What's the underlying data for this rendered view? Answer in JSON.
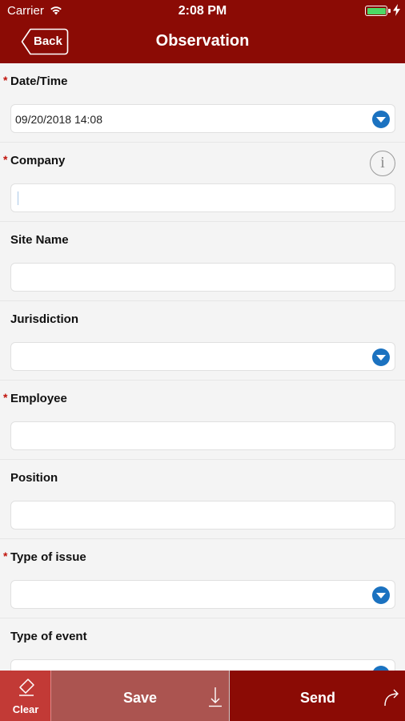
{
  "status_bar": {
    "carrier": "Carrier",
    "time": "2:08 PM"
  },
  "header": {
    "title": "Observation",
    "back_label": "Back"
  },
  "fields": {
    "datetime": {
      "label": "Date/Time",
      "required": "*",
      "value": "09/20/2018 14:08",
      "control": "dropdown"
    },
    "company": {
      "label": "Company",
      "required": "*",
      "value": "",
      "info_icon": "i"
    },
    "site_name": {
      "label": "Site Name",
      "value": ""
    },
    "jurisdiction": {
      "label": "Jurisdiction",
      "value": "",
      "control": "dropdown"
    },
    "employee": {
      "label": "Employee",
      "required": "*",
      "value": ""
    },
    "position": {
      "label": "Position",
      "value": ""
    },
    "type_of_issue": {
      "label": "Type of issue",
      "required": "*",
      "value": "",
      "control": "dropdown"
    },
    "type_of_event": {
      "label": "Type of event",
      "value": "",
      "control": "dropdown"
    }
  },
  "toolbar": {
    "clear_label": "Clear",
    "save_label": "Save",
    "send_label": "Send"
  },
  "colors": {
    "brand": "#8b0b05",
    "required": "#c0130b",
    "dropdown": "#1b72c0",
    "battery": "#4cd964",
    "save_bg": "#ab5450",
    "clear_bg": "#c23a36"
  },
  "icons": {
    "wifi": "wifi-icon",
    "battery": "battery-icon",
    "charging": "charging-icon",
    "back": "back-arrow-icon",
    "info": "info-icon",
    "dropdown": "chevron-down-circle-icon",
    "clear": "eraser-icon",
    "save": "download-icon",
    "send": "forward-arrow-icon"
  }
}
